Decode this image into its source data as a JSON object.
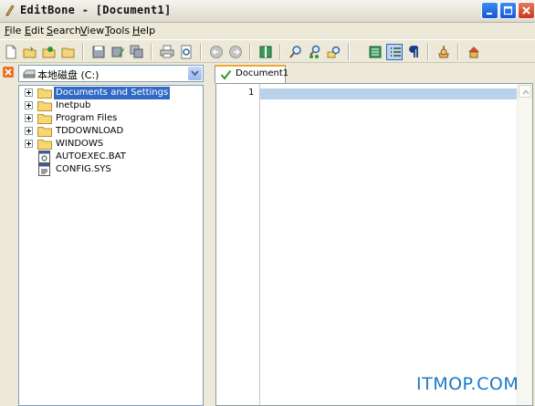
{
  "window": {
    "title": "EditBone - [Document1]",
    "minimize_icon": "minimize-icon",
    "maximize_icon": "maximize-icon",
    "close_icon": "close-icon"
  },
  "menu": [
    {
      "label": "File",
      "accel": "F",
      "rest": "ile"
    },
    {
      "label": "Edit",
      "accel": "E",
      "rest": "dit"
    },
    {
      "label": "Search",
      "accel": "S",
      "rest": "earch"
    },
    {
      "label": "View",
      "accel": "V",
      "rest": "iew"
    },
    {
      "label": "Tools",
      "accel": "T",
      "rest": "ools"
    },
    {
      "label": "Help",
      "accel": "H",
      "rest": "elp"
    }
  ],
  "toolbar": {
    "icons": [
      "new-file-icon",
      "open-icon",
      "open-folder-icon",
      "folder-icon",
      "save-icon",
      "save-as-icon",
      "save-all-icon",
      "print-icon",
      "print-preview-icon",
      "undo-icon",
      "redo-icon",
      "column-icon",
      "find-icon",
      "find-next-icon",
      "replace-icon",
      "wordwrap-icon",
      "line-numbers-icon",
      "pilcrow-icon",
      "macro-icon",
      "home-icon"
    ],
    "pressed": "line-numbers-icon"
  },
  "explorer": {
    "drive": "本地磁盘 (C:)",
    "items": [
      {
        "label": "Documents and Settings",
        "type": "folder",
        "selected": true
      },
      {
        "label": "Inetpub",
        "type": "folder"
      },
      {
        "label": "Program Files",
        "type": "folder"
      },
      {
        "label": "TDDOWNLOAD",
        "type": "folder"
      },
      {
        "label": "WINDOWS",
        "type": "folder"
      },
      {
        "label": "AUTOEXEC.BAT",
        "type": "file"
      },
      {
        "label": "CONFIG.SYS",
        "type": "file"
      }
    ]
  },
  "editor": {
    "tab_label": "Document1",
    "line_number": "1"
  },
  "watermark": "ITMOP.COM",
  "colors": {
    "selection": "#316ac5",
    "current_line": "#b9d1ea",
    "accent_tab": "#f0a830",
    "watermark": "#1a78c9"
  }
}
